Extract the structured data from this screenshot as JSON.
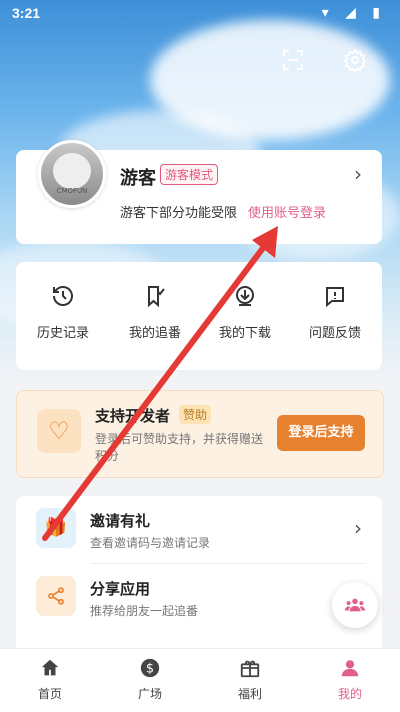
{
  "status_bar": {
    "time": "3:21",
    "icons_text": "▾ ◢ ▮"
  },
  "header": {
    "scan_icon": "scan-icon",
    "settings_icon": "gear-icon"
  },
  "profile": {
    "username": "游客",
    "mode_badge": "游客模式",
    "limit_text": "游客下部分功能受限",
    "login_link": "使用账号登录",
    "avatar_tag": "CMOFUN"
  },
  "quick_actions": [
    {
      "label": "历史记录",
      "icon": "history-icon"
    },
    {
      "label": "我的追番",
      "icon": "bookmark-icon"
    },
    {
      "label": "我的下载",
      "icon": "download-icon"
    },
    {
      "label": "问题反馈",
      "icon": "feedback-icon"
    }
  ],
  "support": {
    "title": "支持开发者",
    "badge": "赞助",
    "desc": "登录后可赞助支持，并获得赠送积分",
    "button": "登录后支持"
  },
  "list": [
    {
      "title": "邀请有礼",
      "sub": "查看邀请码与邀请记录",
      "icon": "gift-icon"
    },
    {
      "title": "分享应用",
      "sub": "推荐给朋友一起追番",
      "icon": "share-icon"
    }
  ],
  "tabbar": [
    {
      "label": "首页",
      "icon": "home-icon"
    },
    {
      "label": "广场",
      "icon": "dollar-icon"
    },
    {
      "label": "福利",
      "icon": "gift-box-icon"
    },
    {
      "label": "我的",
      "icon": "person-icon",
      "active": true
    }
  ],
  "colors": {
    "accent": "#e0608a",
    "support_button": "#e7812f",
    "annotation_arrow": "#e53935"
  }
}
